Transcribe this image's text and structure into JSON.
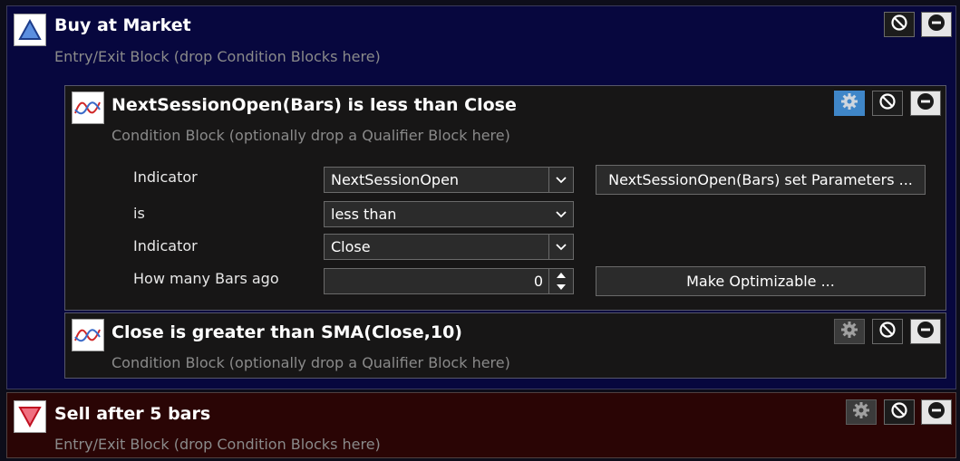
{
  "entry_block": {
    "title": "Buy at Market",
    "subtitle": "Entry/Exit Block (drop Condition Blocks here)",
    "icon": "triangle-up-icon",
    "accent": "#07073e"
  },
  "condition_1": {
    "title": "NextSessionOpen(Bars) is less than Close",
    "subtitle": "Condition Block (optionally drop a Qualifier Block here)",
    "icon": "indicator-chart-icon",
    "rows": {
      "indicator1_label": "Indicator",
      "indicator1_value": "NextSessionOpen",
      "set_params_label": "NextSessionOpen(Bars) set Parameters ...",
      "is_label": "is",
      "is_value": "less than",
      "indicator2_label": "Indicator",
      "indicator2_value": "Close",
      "bars_ago_label": "How many Bars ago",
      "bars_ago_value": "0",
      "optimizable_label": "Make Optimizable ..."
    }
  },
  "condition_2": {
    "title": "Close is greater than SMA(Close,10)",
    "subtitle": "Condition Block (optionally drop a Qualifier Block here)",
    "icon": "indicator-chart-icon"
  },
  "exit_block": {
    "title": "Sell after 5 bars",
    "subtitle": "Entry/Exit Block (drop Condition Blocks here)",
    "icon": "triangle-down-icon",
    "accent": "#2a0505"
  },
  "icons": {
    "gear": "gear-icon",
    "disable": "no-entry-icon",
    "remove": "minus-circle-icon"
  },
  "colors": {
    "selected_gear": "#3f86c8"
  }
}
